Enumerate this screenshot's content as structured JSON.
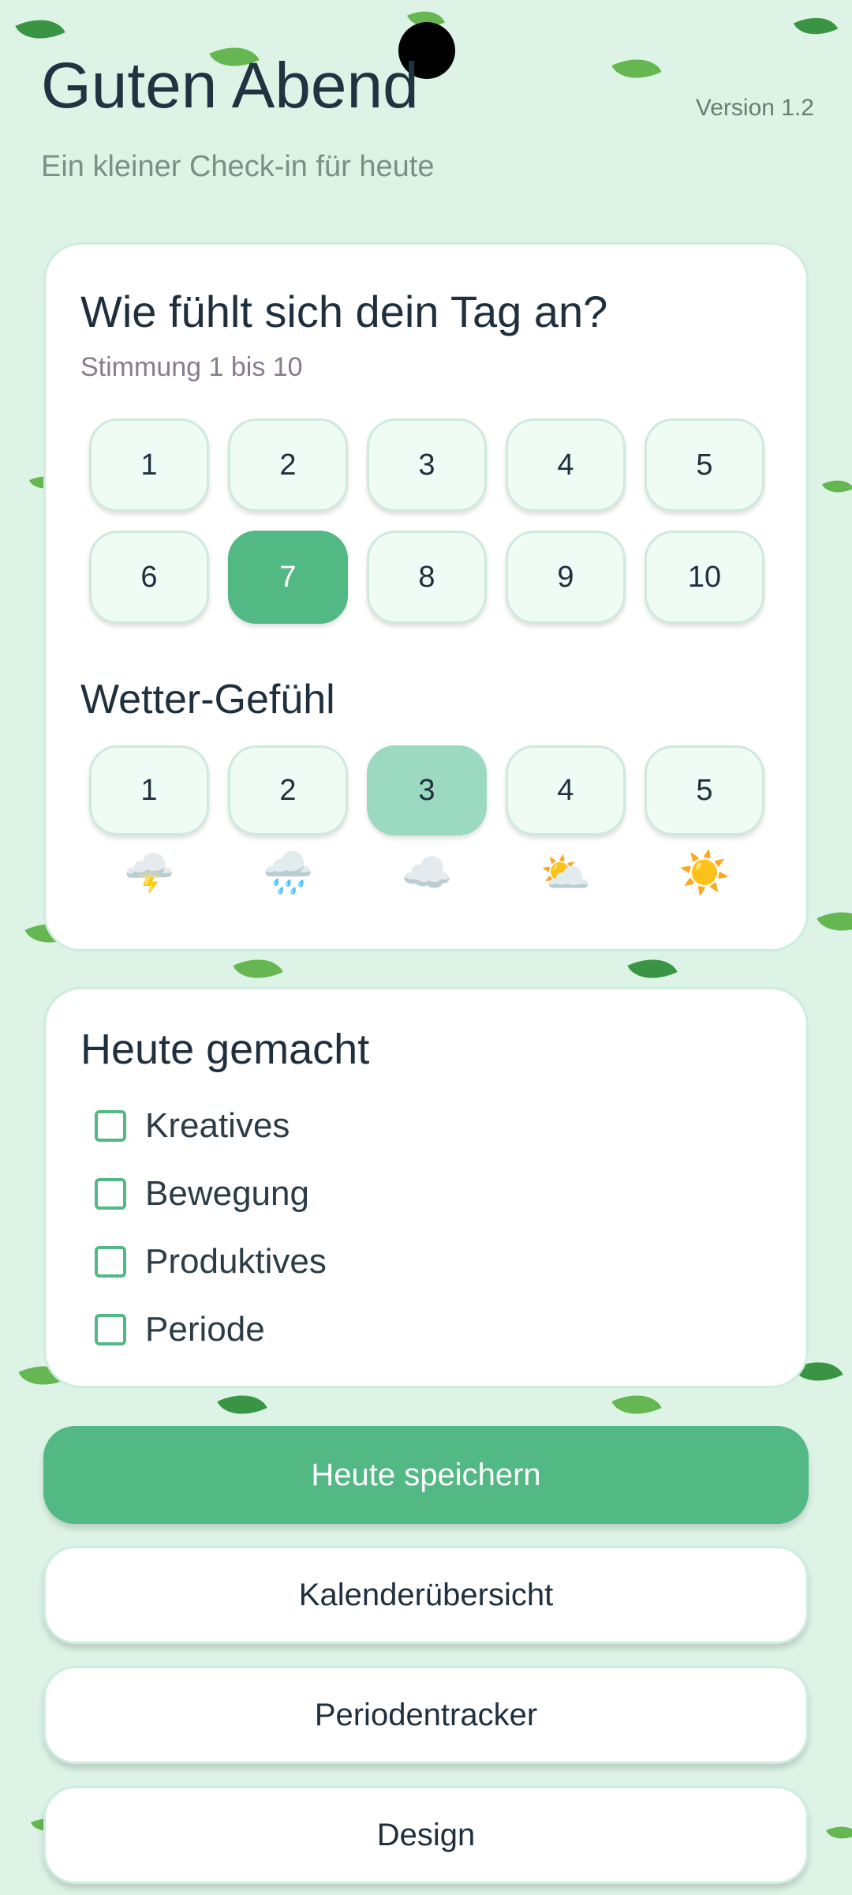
{
  "header": {
    "greeting": "Guten Abend",
    "subtitle": "Ein kleiner Check-in für heute",
    "version": "Version 1.2"
  },
  "mood": {
    "title": "Wie fühlt sich dein Tag an?",
    "hint": "Stimmung 1 bis 10",
    "options": [
      "1",
      "2",
      "3",
      "4",
      "5",
      "6",
      "7",
      "8",
      "9",
      "10"
    ],
    "selected": "7"
  },
  "weather": {
    "title": "Wetter-Gefühl",
    "options": [
      "1",
      "2",
      "3",
      "4",
      "5"
    ],
    "selected": "3",
    "icons": [
      "🌩️",
      "🌧️",
      "☁️",
      "⛅",
      "☀️"
    ],
    "icon_names": [
      "thunderstorm-icon",
      "rain-icon",
      "cloud-icon",
      "partly-sunny-icon",
      "sun-icon"
    ]
  },
  "done": {
    "title": "Heute gemacht",
    "items": [
      "Kreatives",
      "Bewegung",
      "Produktives",
      "Periode"
    ]
  },
  "buttons": {
    "save": "Heute speichern",
    "calendar": "Kalenderübersicht",
    "period": "Periodentracker",
    "design": "Design"
  },
  "colors": {
    "background": "#dcf3e6",
    "accent": "#52b884",
    "weather_selected": "#9bd9c0",
    "button_bg": "#eefcf5"
  }
}
